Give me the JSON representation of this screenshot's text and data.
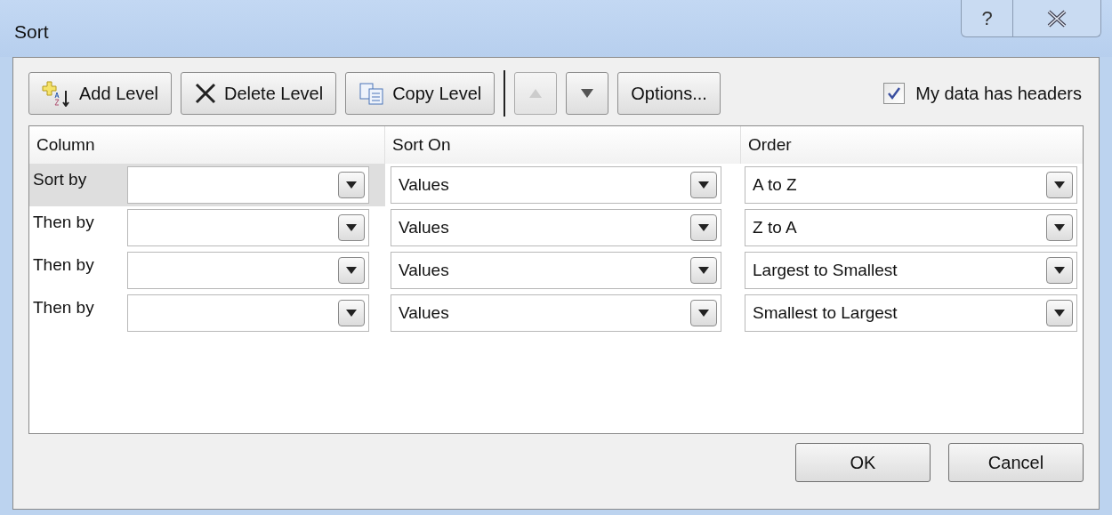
{
  "window": {
    "title": "Sort",
    "help_button": "?"
  },
  "toolbar": {
    "buttons": [
      {
        "kind": "add",
        "label": "Add Level"
      },
      {
        "kind": "delete",
        "label": "Delete Level"
      },
      {
        "kind": "copy",
        "label": "Copy Level"
      },
      {
        "kind": "up",
        "disabled": true
      },
      {
        "kind": "down",
        "disabled": false
      },
      {
        "kind": "text",
        "label": "Options..."
      }
    ],
    "headers_checkbox": {
      "label": "My data has headers",
      "checked": true
    }
  },
  "table": {
    "columns": [
      "Column",
      "Sort On",
      "Order"
    ],
    "rows": [
      {
        "label": "Sort by",
        "sort_on": "Values",
        "order": "A to Z",
        "selected": true
      },
      {
        "label": "Then by",
        "sort_on": "Values",
        "order": "Z to A",
        "selected": false
      },
      {
        "label": "Then by",
        "sort_on": "Values",
        "order": "Largest to Smallest",
        "selected": false
      },
      {
        "label": "Then by",
        "sort_on": "Values",
        "order": "Smallest to Largest",
        "selected": false
      }
    ]
  },
  "buttons": [
    "OK",
    "Cancel"
  ]
}
